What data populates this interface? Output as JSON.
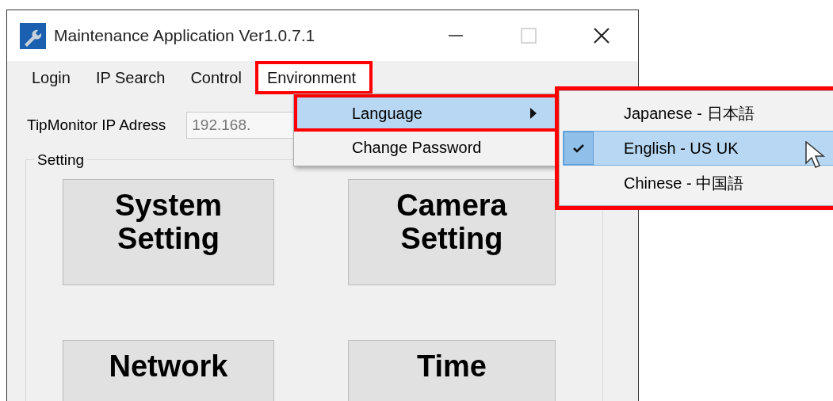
{
  "window": {
    "title": "Maintenance Application Ver1.0.7.1"
  },
  "window_buttons": [
    {
      "kind": "minimize",
      "disabled": false
    },
    {
      "kind": "maximize",
      "disabled": true
    },
    {
      "kind": "close",
      "disabled": false
    }
  ],
  "menu": [
    {
      "label": "Login",
      "open": false,
      "highlighted": false
    },
    {
      "label": "IP Search",
      "open": false,
      "highlighted": false
    },
    {
      "label": "Control",
      "open": false,
      "highlighted": false
    },
    {
      "label": "Environment",
      "open": true,
      "highlighted": true
    }
  ],
  "dropdown": [
    {
      "label": "Language",
      "selected": true,
      "highlighted": true,
      "has_submenu": true
    },
    {
      "label": "Change Password",
      "selected": false,
      "highlighted": false,
      "has_submenu": false
    }
  ],
  "submenu": {
    "highlighted": true,
    "items": [
      {
        "label": "Japanese - 日本語",
        "checked": false,
        "selected": false
      },
      {
        "label": "English - US UK",
        "checked": true,
        "selected": true
      },
      {
        "label": "Chinese - 中国語",
        "checked": false,
        "selected": false
      }
    ]
  },
  "ip_address": {
    "label": "TipMonitor IP Adress",
    "value": "192.168."
  },
  "setting_group": {
    "title": "Setting",
    "buttons": [
      "System Setting",
      "Camera Setting",
      "Network",
      "Time"
    ]
  }
}
